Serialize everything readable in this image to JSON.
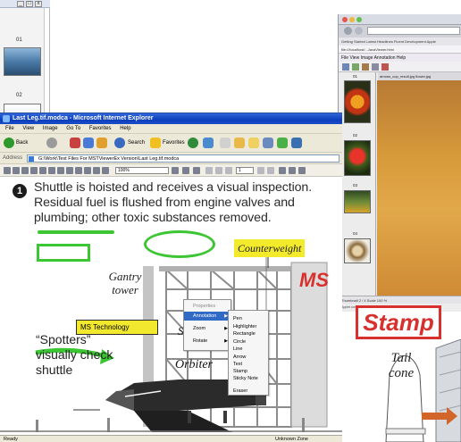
{
  "back_left": {
    "page_labels": [
      "01",
      "02"
    ],
    "controls": [
      "_",
      "□",
      "x"
    ]
  },
  "back_right": {
    "bookmarks": "Getting Started  Latest Headlines  Fluent Development  Apple",
    "url": "file:///localhost/...JavaViewer.html",
    "menu": "File  View  Image  Annotation  Help",
    "tabs": "arrows_cop_result.jpg  flower.jpg",
    "page_numbers": [
      "01",
      "02",
      "03",
      "04"
    ],
    "status": "Thumbnail 2 / 4        Scale 100 %",
    "status2": "Applet com.ms.viewer.ImageViewer started"
  },
  "main_window": {
    "title": "Last Leg.tif.modca - Microsoft Internet Explorer",
    "menu": [
      "File",
      "View",
      "Image",
      "Go To",
      "Favorites",
      "Help"
    ],
    "toolbar": {
      "back": "Back",
      "search": "Search",
      "favorites": "Favorites"
    },
    "address_label": "Address",
    "address_value": "G:\\Work\\Test Files For MSTViewerEx Version\\Last Leg.tif.modca",
    "zoom": "100%",
    "page": "1",
    "status": "Ready",
    "zone": "Unknown Zone"
  },
  "document": {
    "caption_number": "1",
    "caption": "Shuttle is hoisted and receives a visual inspection. Residual fuel is flushed from engine valves and plumbing; other toxic substances removed.",
    "counterweight": "Counterweight",
    "ms_big": "MS",
    "gantry": "Gantry tower",
    "ms_technology": "MS Technology",
    "spotters": "“Spotters” visually check shuttle",
    "orbiter": "Orbiter",
    "s_letter": "S"
  },
  "context_menu": {
    "items": [
      "Properties",
      "Annotation",
      "Zoom",
      "Rotate"
    ],
    "highlighted": "Annotation"
  },
  "annotation_submenu": {
    "items": [
      "Pen",
      "Highlighter",
      "Rectangle",
      "Circle",
      "Line",
      "Arrow",
      "Text",
      "Stamp",
      "Sticky Note",
      "Eraser"
    ]
  },
  "stamp": {
    "label": "Stamp",
    "tail_cone": "Tail cone"
  },
  "colors": {
    "annotation_green": "#3cc634",
    "stamp_red": "#d8302c",
    "label_yellow": "#f3ea2c",
    "xp_title_blue": "#0d3fbc",
    "menu_highlight": "#316ac5"
  }
}
